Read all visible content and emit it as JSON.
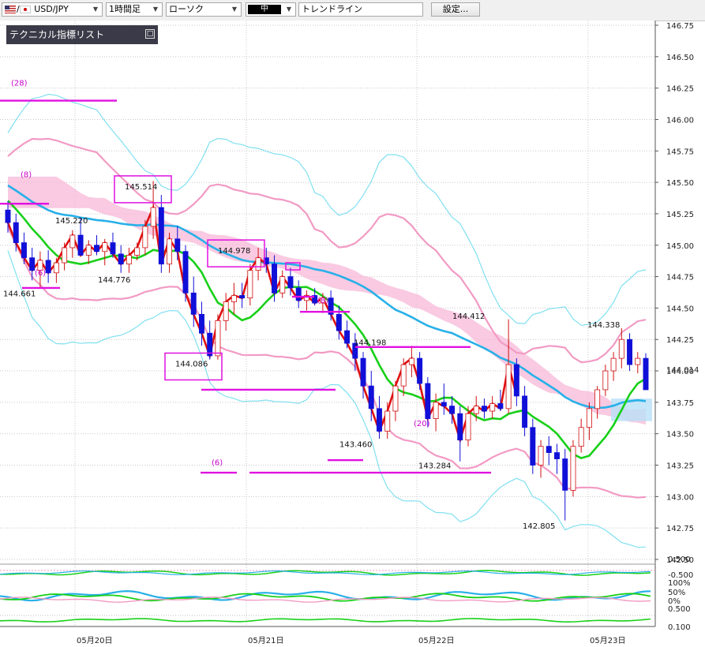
{
  "toolbar": {
    "symbol": "USD/JPY",
    "timeframe": "1時間足",
    "chart_type": "ローソク",
    "line_width": "中",
    "tool": "トレンドライン",
    "settings_label": "設定..."
  },
  "indicator_panel": {
    "title": "テクニカル指標リスト"
  },
  "colors": {
    "up_candle": "#ffffff",
    "down_candle": "#1010d8",
    "ichimoku_cloud": "#f7b8d8",
    "bb_outer": "#80e0f0",
    "bb_inner": "#f29ac4",
    "ma_green": "#18d018",
    "ma_blue": "#28b0e8",
    "red_line": "#e01010",
    "magenta": "#e010e0"
  },
  "chart_data": {
    "type": "candlestick",
    "ylim": [
      142.5,
      146.75
    ],
    "y_ticks": [
      "146.75",
      "146.50",
      "146.25",
      "146.00",
      "145.75",
      "145.50",
      "145.25",
      "145.00",
      "144.75",
      "144.50",
      "144.25",
      "144.00",
      "143.75",
      "143.50",
      "143.25",
      "143.00",
      "142.75",
      "142.50"
    ],
    "x_labels": [
      "05月20日",
      "05月21日",
      "05月22日",
      "05月23日"
    ],
    "current_price": "144.014",
    "price_labels": [
      "145.514",
      "145.220",
      "144.978",
      "144.776",
      "144.661",
      "144.412",
      "144.338",
      "144.198",
      "144.086",
      "143.460",
      "143.284",
      "142.805"
    ],
    "period_labels": [
      "(28)",
      "(8)",
      "(6)",
      "(8)",
      "(6)",
      "(20)"
    ],
    "sub_labels": [
      "0.500",
      "-0.500",
      "100%",
      "50%",
      "0%",
      "0.500",
      "0.100"
    ],
    "candles": [
      [
        145.28,
        145.35,
        145.1,
        145.18
      ],
      [
        145.18,
        145.25,
        144.95,
        145.02
      ],
      [
        145.02,
        145.1,
        144.85,
        144.9
      ],
      [
        144.9,
        144.98,
        144.72,
        144.8
      ],
      [
        144.8,
        144.95,
        144.66,
        144.88
      ],
      [
        144.88,
        144.96,
        144.7,
        144.78
      ],
      [
        144.78,
        144.9,
        144.7,
        144.86
      ],
      [
        144.86,
        145.02,
        144.8,
        144.98
      ],
      [
        144.98,
        145.12,
        144.9,
        145.08
      ],
      [
        145.08,
        145.22,
        144.95,
        144.92
      ],
      [
        144.92,
        145.04,
        144.85,
        145.0
      ],
      [
        145.0,
        145.08,
        144.92,
        144.95
      ],
      [
        144.95,
        145.05,
        144.84,
        145.02
      ],
      [
        145.02,
        145.1,
        144.9,
        144.93
      ],
      [
        144.93,
        145.0,
        144.78,
        144.85
      ],
      [
        144.85,
        144.98,
        144.78,
        144.92
      ],
      [
        144.92,
        145.02,
        144.88,
        144.98
      ],
      [
        144.98,
        145.2,
        144.92,
        145.15
      ],
      [
        145.15,
        145.51,
        145.05,
        145.3
      ],
      [
        145.3,
        145.4,
        144.78,
        144.85
      ],
      [
        144.85,
        145.1,
        144.78,
        145.05
      ],
      [
        145.05,
        145.15,
        144.88,
        144.95
      ],
      [
        144.95,
        145.0,
        144.55,
        144.62
      ],
      [
        144.62,
        144.75,
        144.35,
        144.45
      ],
      [
        144.45,
        144.55,
        144.2,
        144.3
      ],
      [
        144.3,
        144.4,
        144.09,
        144.12
      ],
      [
        144.12,
        144.45,
        144.09,
        144.4
      ],
      [
        144.4,
        144.62,
        144.32,
        144.55
      ],
      [
        144.55,
        144.7,
        144.45,
        144.6
      ],
      [
        144.6,
        144.7,
        144.5,
        144.58
      ],
      [
        144.58,
        144.85,
        144.52,
        144.8
      ],
      [
        144.8,
        144.98,
        144.72,
        144.9
      ],
      [
        144.9,
        144.98,
        144.78,
        144.85
      ],
      [
        144.85,
        144.92,
        144.55,
        144.62
      ],
      [
        144.62,
        144.8,
        144.58,
        144.75
      ],
      [
        144.75,
        144.82,
        144.6,
        144.66
      ],
      [
        144.66,
        144.72,
        144.5,
        144.56
      ],
      [
        144.56,
        144.64,
        144.48,
        144.6
      ],
      [
        144.6,
        144.66,
        144.52,
        144.54
      ],
      [
        144.54,
        144.62,
        144.46,
        144.58
      ],
      [
        144.58,
        144.64,
        144.4,
        144.45
      ],
      [
        144.45,
        144.52,
        144.25,
        144.32
      ],
      [
        144.32,
        144.4,
        144.18,
        144.22
      ],
      [
        144.22,
        144.3,
        144.0,
        144.1
      ],
      [
        144.1,
        144.15,
        143.78,
        143.88
      ],
      [
        143.88,
        144.0,
        143.6,
        143.7
      ],
      [
        143.7,
        143.8,
        143.46,
        143.52
      ],
      [
        143.52,
        143.75,
        143.46,
        143.68
      ],
      [
        143.68,
        143.92,
        143.6,
        143.88
      ],
      [
        143.88,
        144.1,
        143.8,
        144.05
      ],
      [
        144.05,
        144.2,
        143.95,
        144.1
      ],
      [
        144.1,
        144.15,
        143.85,
        143.9
      ],
      [
        143.9,
        143.95,
        143.55,
        143.62
      ],
      [
        143.62,
        143.82,
        143.52,
        143.75
      ],
      [
        143.75,
        143.9,
        143.65,
        143.72
      ],
      [
        143.72,
        143.8,
        143.58,
        143.66
      ],
      [
        143.66,
        143.72,
        143.28,
        143.45
      ],
      [
        143.45,
        143.72,
        143.4,
        143.66
      ],
      [
        143.66,
        143.8,
        143.6,
        143.72
      ],
      [
        143.72,
        143.78,
        143.62,
        143.68
      ],
      [
        143.68,
        143.8,
        143.62,
        143.74
      ],
      [
        143.74,
        143.85,
        143.68,
        143.7
      ],
      [
        143.7,
        144.41,
        143.66,
        144.05
      ],
      [
        144.05,
        144.1,
        143.72,
        143.8
      ],
      [
        143.8,
        143.88,
        143.48,
        143.55
      ],
      [
        143.55,
        143.62,
        143.18,
        143.25
      ],
      [
        143.25,
        143.45,
        143.15,
        143.4
      ],
      [
        143.4,
        143.48,
        143.25,
        143.35
      ],
      [
        143.35,
        143.42,
        143.18,
        143.3
      ],
      [
        143.3,
        143.38,
        142.81,
        143.05
      ],
      [
        143.05,
        143.45,
        143.0,
        143.4
      ],
      [
        143.4,
        143.62,
        143.35,
        143.55
      ],
      [
        143.55,
        143.75,
        143.45,
        143.7
      ],
      [
        143.7,
        143.88,
        143.62,
        143.85
      ],
      [
        143.85,
        144.05,
        143.8,
        144.0
      ],
      [
        144.0,
        144.15,
        143.92,
        144.1
      ],
      [
        144.1,
        144.34,
        144.02,
        144.25
      ],
      [
        144.25,
        144.3,
        144.0,
        144.05
      ],
      [
        144.05,
        144.15,
        143.98,
        144.1
      ],
      [
        144.1,
        144.14,
        143.85,
        143.85
      ]
    ]
  }
}
